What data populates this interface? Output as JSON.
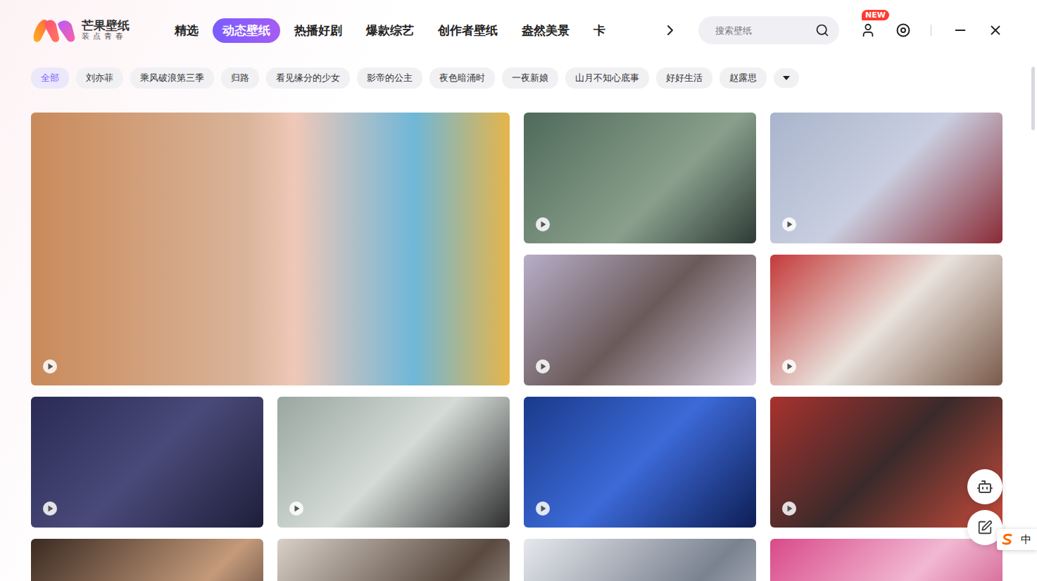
{
  "app": {
    "name": "芒果壁纸",
    "slogan": "装点青春"
  },
  "nav": {
    "tabs": [
      {
        "label": "精选",
        "selected": false
      },
      {
        "label": "动态壁纸",
        "selected": true
      },
      {
        "label": "热播好剧",
        "selected": false
      },
      {
        "label": "爆款综艺",
        "selected": false
      },
      {
        "label": "创作者壁纸",
        "selected": false
      },
      {
        "label": "盎然美景",
        "selected": false
      },
      {
        "label": "卡",
        "selected": false
      }
    ]
  },
  "search": {
    "placeholder": "搜索壁纸"
  },
  "user": {
    "badge": "NEW"
  },
  "filters": [
    {
      "label": "全部",
      "selected": true
    },
    {
      "label": "刘亦菲",
      "selected": false
    },
    {
      "label": "乘风破浪第三季",
      "selected": false
    },
    {
      "label": "归路",
      "selected": false
    },
    {
      "label": "看见缘分的少女",
      "selected": false
    },
    {
      "label": "影帝的公主",
      "selected": false
    },
    {
      "label": "夜色暗涌时",
      "selected": false
    },
    {
      "label": "一夜新娘",
      "selected": false
    },
    {
      "label": "山月不知心底事",
      "selected": false
    },
    {
      "label": "好好生活",
      "selected": false
    },
    {
      "label": "赵露思",
      "selected": false
    }
  ],
  "wallpapers": [
    {
      "kind": "featured"
    },
    {
      "kind": "standard"
    },
    {
      "kind": "standard"
    },
    {
      "kind": "standard"
    },
    {
      "kind": "standard"
    },
    {
      "kind": "standard"
    },
    {
      "kind": "standard"
    },
    {
      "kind": "standard"
    },
    {
      "kind": "standard"
    },
    {
      "kind": "standard"
    },
    {
      "kind": "standard"
    },
    {
      "kind": "standard"
    },
    {
      "kind": "standard"
    }
  ],
  "ime": {
    "mode": "中"
  }
}
